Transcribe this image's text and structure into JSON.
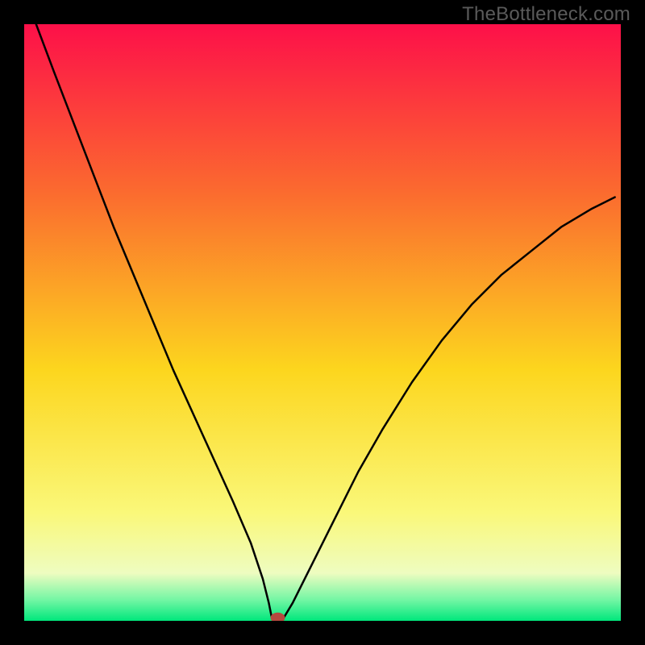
{
  "watermark": "TheBottleneck.com",
  "colors": {
    "background_frame": "#000000",
    "gradient_top": "#fd1049",
    "gradient_upper_mid": "#fb6a2f",
    "gradient_mid": "#fcd61e",
    "gradient_lower_mid": "#faf87a",
    "gradient_pale": "#eefcc0",
    "gradient_green_light": "#73f6a4",
    "gradient_green": "#00e77c",
    "curve_stroke": "#000000",
    "marker_fill": "#b5493f"
  },
  "chart_data": {
    "type": "line",
    "title": "",
    "xlabel": "",
    "ylabel": "",
    "xlim": [
      0,
      100
    ],
    "ylim": [
      0,
      100
    ],
    "series": [
      {
        "name": "left-curve",
        "x": [
          2,
          5,
          10,
          15,
          20,
          25,
          30,
          35,
          38,
          40,
          41,
          41.5
        ],
        "values": [
          100,
          92,
          79,
          66,
          54,
          42,
          31,
          20,
          13,
          7,
          3,
          0.5
        ]
      },
      {
        "name": "right-curve",
        "x": [
          43.5,
          45,
          48,
          52,
          56,
          60,
          65,
          70,
          75,
          80,
          85,
          90,
          95,
          99
        ],
        "values": [
          0.5,
          3,
          9,
          17,
          25,
          32,
          40,
          47,
          53,
          58,
          62,
          66,
          69,
          71
        ]
      }
    ],
    "annotations": [
      {
        "name": "optimal-point",
        "x": 42.5,
        "y": 0.5
      }
    ],
    "grid": false,
    "legend": false
  }
}
